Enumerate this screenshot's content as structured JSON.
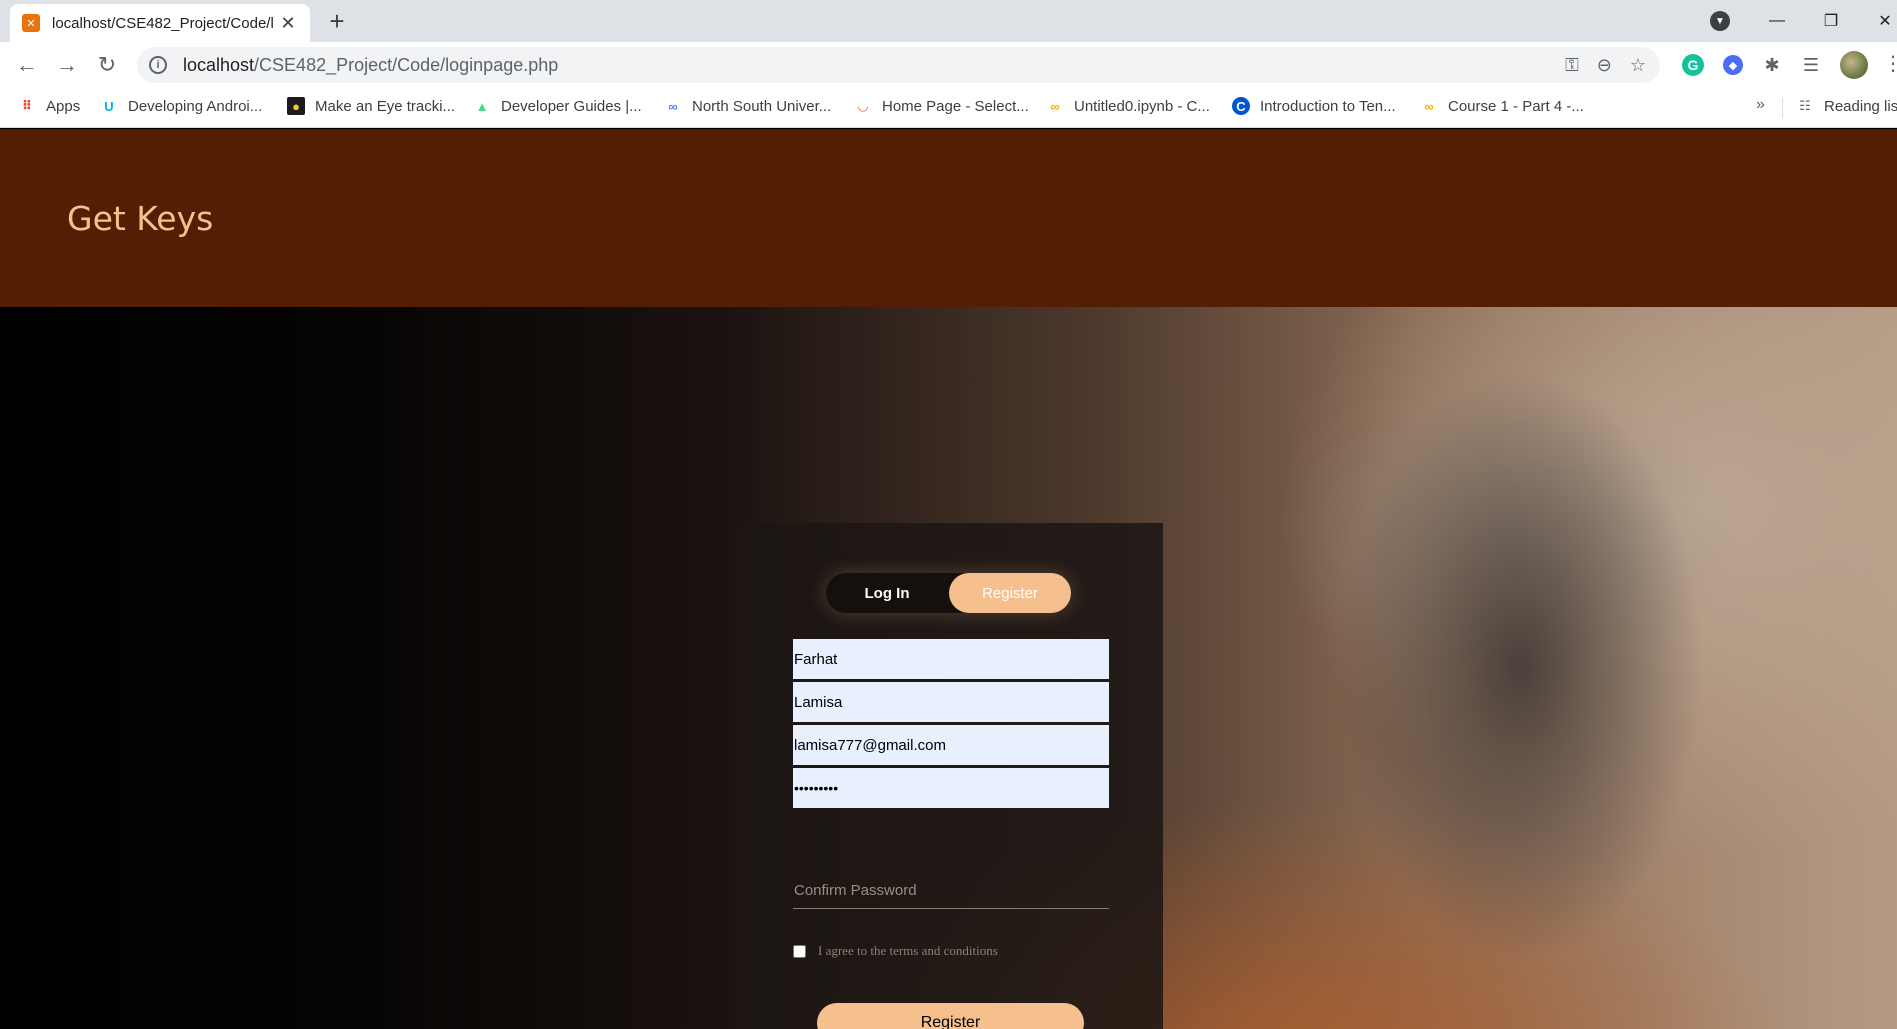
{
  "browser": {
    "tab_title": "localhost/CSE482_Project/Code/l",
    "tab_favicon": "xampp-favicon",
    "new_tab": "+",
    "url_host": "localhost",
    "url_path": "/CSE482_Project/Code/loginpage.php",
    "bookmarks": [
      {
        "label": "Apps",
        "icon": "apps-grid-icon"
      },
      {
        "label": "Developing Androi...",
        "icon": "udacity-icon"
      },
      {
        "label": "Make an Eye tracki...",
        "icon": "instructables-icon"
      },
      {
        "label": "Developer Guides |...",
        "icon": "android-icon"
      },
      {
        "label": "North South Univer...",
        "icon": "colab-icon"
      },
      {
        "label": "Home Page - Select...",
        "icon": "select-icon"
      },
      {
        "label": "Untitled0.ipynb - C...",
        "icon": "colab-icon"
      },
      {
        "label": "Introduction to Ten...",
        "icon": "coursera-icon"
      },
      {
        "label": "Course 1 - Part 4 -...",
        "icon": "colab-icon"
      }
    ],
    "bookmarks_more": "»",
    "reading_list": "Reading list"
  },
  "site": {
    "brand": "Get Keys",
    "accent_color": "#f6c08e",
    "header_color": "#541e05"
  },
  "form": {
    "toggle_login": "Log In",
    "toggle_register": "Register",
    "first_name": "Farhat",
    "last_name": "Lamisa",
    "email": "lamisa777@gmail.com",
    "password_masked": "•••••••••",
    "confirm_placeholder": "Confirm Password",
    "terms_label": "I agree to the terms and conditions",
    "submit_label": "Register"
  }
}
